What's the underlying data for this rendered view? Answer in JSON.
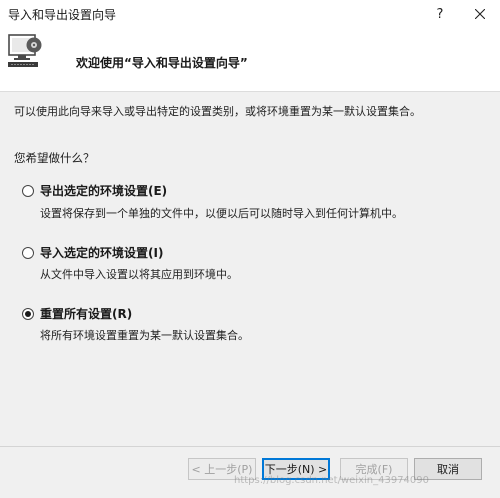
{
  "window": {
    "title": "导入和导出设置向导"
  },
  "titlebar": {
    "help_label": "?"
  },
  "header": {
    "welcome": "欢迎使用“导入和导出设置向导”"
  },
  "intro": "可以使用此向导来导入或导出特定的设置类别，或将环境重置为某一默认设置集合。",
  "question": "您希望做什么？",
  "options": [
    {
      "label": "导出选定的环境设置(E)",
      "desc": "设置将保存到一个单独的文件中，以便以后可以随时导入到任何计算机中。",
      "selected": false
    },
    {
      "label": "导入选定的环境设置(I)",
      "desc": "从文件中导入设置以将其应用到环境中。",
      "selected": false
    },
    {
      "label": "重置所有设置(R)",
      "desc": "将所有环境设置重置为某一默认设置集合。",
      "selected": true
    }
  ],
  "buttons": {
    "prev": "< 上一步(P)",
    "next": "下一步(N) >",
    "finish": "完成(F)",
    "cancel": "取消"
  },
  "watermark": "https://blog.csdn.net/weixin_43974090",
  "colors": {
    "accent": "#0078d7",
    "background": "#f0f0f0",
    "header_bg": "#ffffff"
  }
}
